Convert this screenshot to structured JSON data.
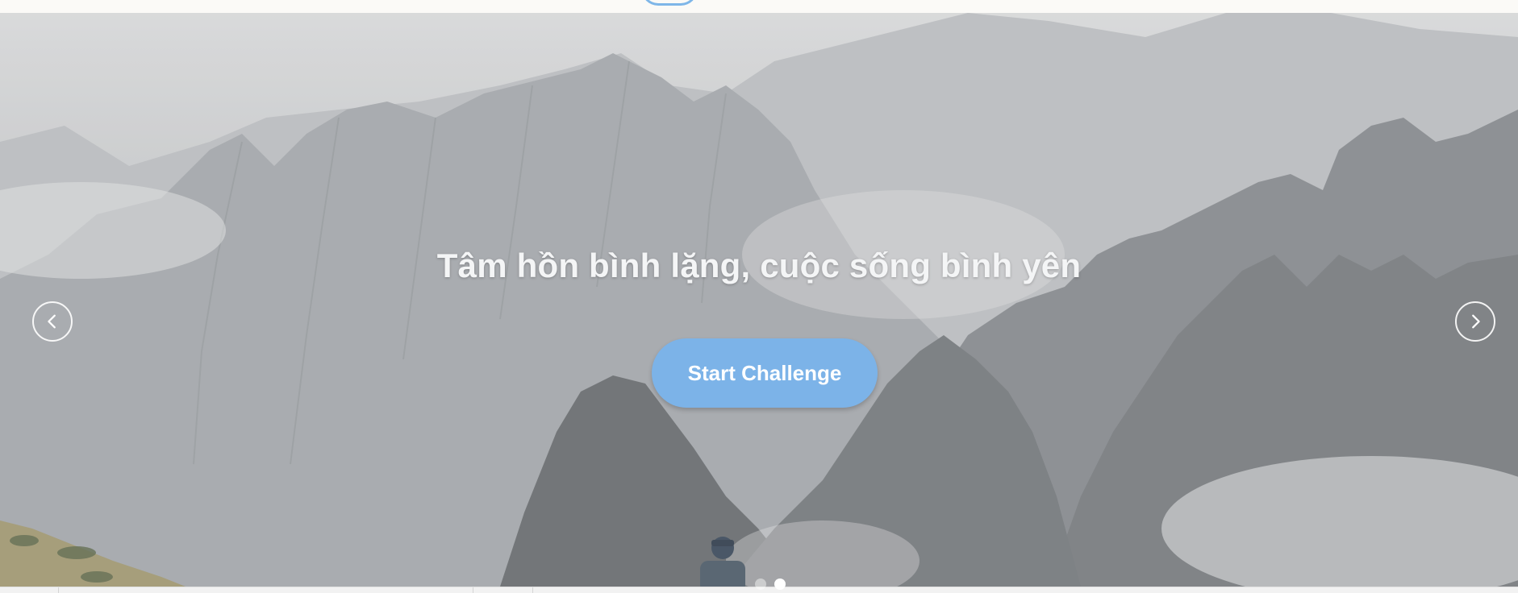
{
  "hero": {
    "headline": "Tâm hồn bình lặng, cuộc sống bình yên",
    "cta_label": "Start Challenge"
  },
  "carousel": {
    "prev_icon": "chevron-left-icon",
    "next_icon": "chevron-right-icon",
    "slide_count": 2,
    "active_slide": 2
  },
  "colors": {
    "accent": "#7cb3e8",
    "headline_text": "#f4f5f6",
    "topbar_bg": "#fbfaf7"
  }
}
